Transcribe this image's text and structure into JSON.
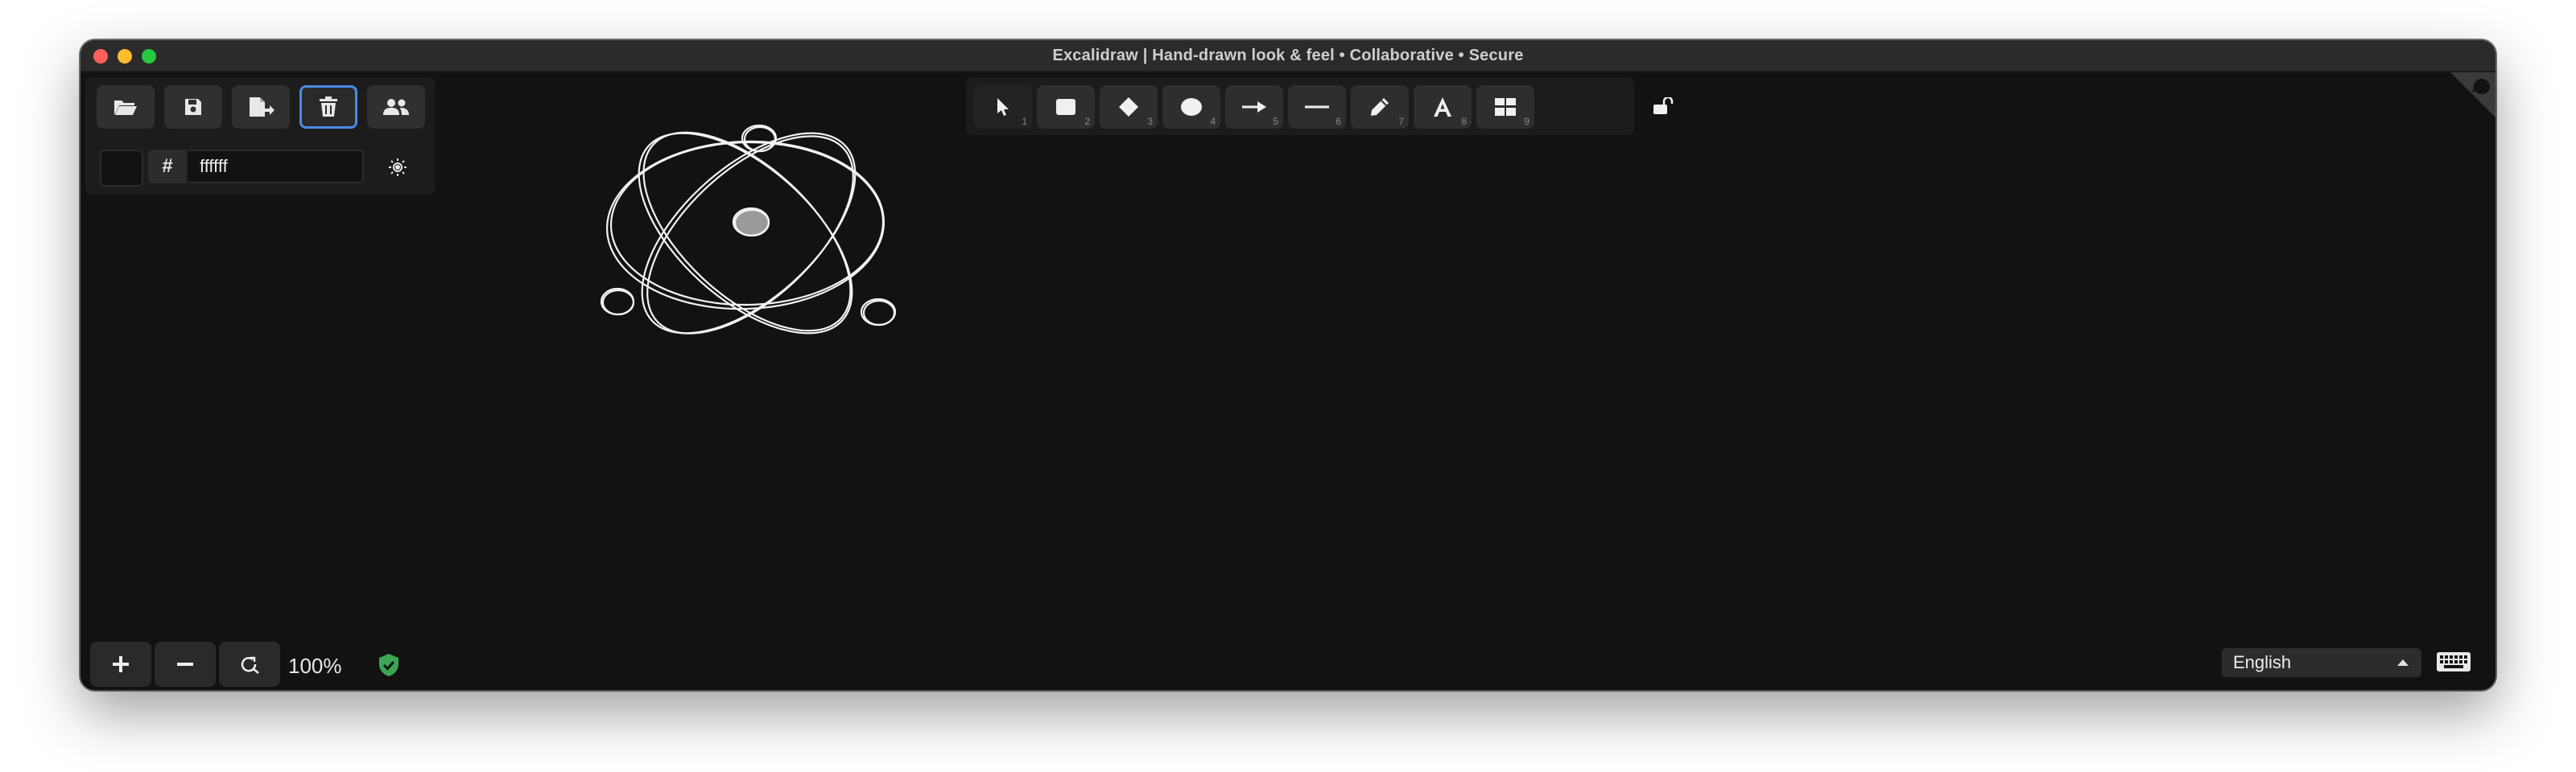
{
  "window": {
    "title": "Excalidraw | Hand-drawn look & feel • Collaborative • Secure"
  },
  "menu_panel": {
    "buttons": [
      {
        "name": "open",
        "icon": "folder-open-icon"
      },
      {
        "name": "save",
        "icon": "floppy-disk-icon"
      },
      {
        "name": "export",
        "icon": "export-file-icon"
      },
      {
        "name": "clear-canvas",
        "icon": "trash-icon",
        "active": true
      },
      {
        "name": "collaborate",
        "icon": "users-icon"
      }
    ],
    "background_color": {
      "hash": "#",
      "value": "ffffff",
      "swatch_color": "#121212"
    },
    "theme_toggle_icon": "sun-icon"
  },
  "toolbar": {
    "tools": [
      {
        "name": "selection",
        "icon": "pointer-icon",
        "key": "1"
      },
      {
        "name": "rectangle",
        "icon": "rectangle-icon",
        "key": "2"
      },
      {
        "name": "diamond",
        "icon": "diamond-icon",
        "key": "3"
      },
      {
        "name": "ellipse",
        "icon": "ellipse-icon",
        "key": "4"
      },
      {
        "name": "arrow",
        "icon": "arrow-icon",
        "key": "5"
      },
      {
        "name": "line",
        "icon": "line-icon",
        "key": "6"
      },
      {
        "name": "draw",
        "icon": "pencil-icon",
        "key": "7"
      },
      {
        "name": "text",
        "icon": "text-icon",
        "key": "8"
      },
      {
        "name": "library",
        "icon": "library-icon",
        "key": "9"
      }
    ],
    "lock_icon": "unlock-icon"
  },
  "footer": {
    "zoom_level": "100%",
    "zoom_in_icon": "plus-icon",
    "zoom_out_icon": "minus-icon",
    "reset_zoom_icon": "reset-zoom-icon",
    "security_icon": "shield-check-icon",
    "language": "English",
    "keyboard_icon": "keyboard-icon"
  },
  "colors": {
    "accent": "#4a8be6",
    "canvas_bg": "#121212",
    "shield_green": "#3aa655"
  }
}
